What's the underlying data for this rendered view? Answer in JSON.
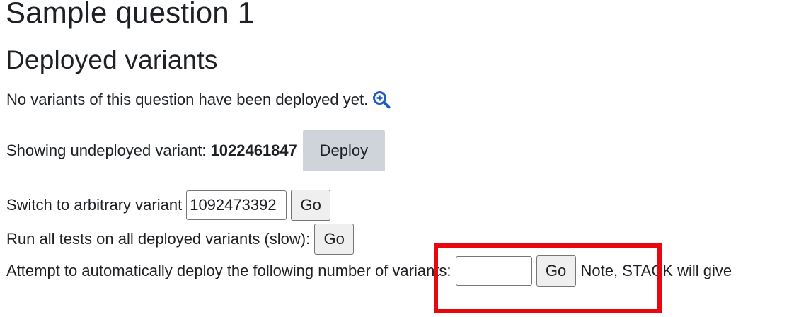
{
  "page_title": "Sample question 1",
  "section_title": "Deployed variants",
  "no_variants_text": "No variants of this question have been deployed yet.",
  "zoom_icon": "magnify-plus-icon",
  "undeployed": {
    "label": "Showing undeployed variant:",
    "variant_number": "1022461847",
    "deploy_label": "Deploy"
  },
  "switch_variant": {
    "label": "Switch to arbitrary variant",
    "input_value": "1092473392",
    "go_label": "Go"
  },
  "run_tests": {
    "label": "Run all tests on all deployed variants (slow):",
    "go_label": "Go"
  },
  "auto_deploy": {
    "label": "Attempt to automatically deploy the following number of variants:",
    "input_value": "",
    "go_label": "Go",
    "note": "Note, STACK will give"
  },
  "colors": {
    "highlight": "#e8070f",
    "icon": "#1f5bbf",
    "deploy_button_bg": "#ced4da"
  }
}
